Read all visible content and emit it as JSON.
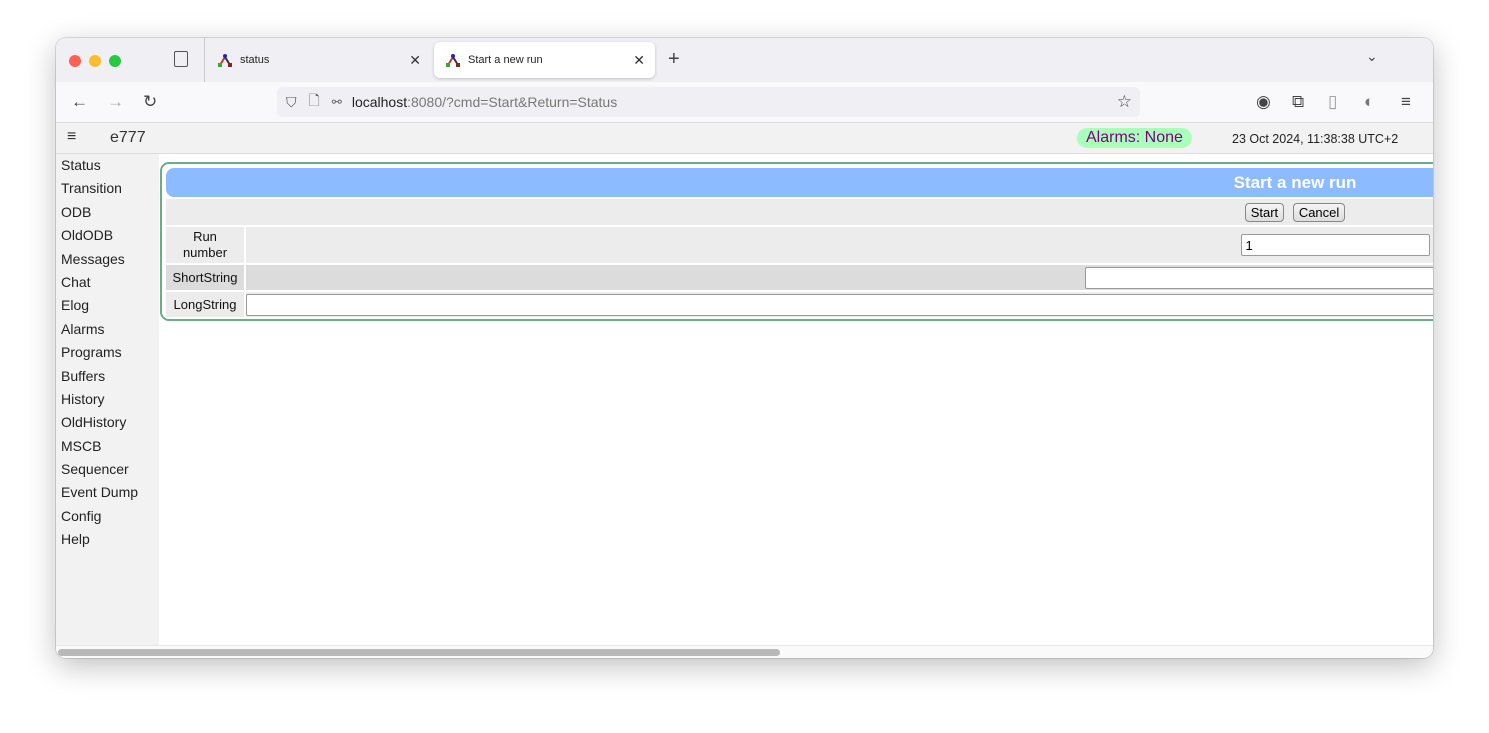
{
  "browser": {
    "tabs": [
      {
        "label": "status",
        "active": false
      },
      {
        "label": "Start a new run",
        "active": true
      }
    ],
    "url_host": "localhost",
    "url_rest": ":8080/?cmd=Start&Return=Status"
  },
  "header": {
    "experiment": "e777",
    "alarms": "Alarms: None",
    "datetime": "23 Oct 2024, 11:38:38 UTC+2"
  },
  "sidebar": {
    "items": [
      "Status",
      "Transition",
      "ODB",
      "OldODB",
      "Messages",
      "Chat",
      "Elog",
      "Alarms",
      "Programs",
      "Buffers",
      "History",
      "OldHistory",
      "MSCB",
      "Sequencer",
      "Event Dump",
      "Config",
      "Help"
    ]
  },
  "form": {
    "title": "Start a new run",
    "start_label": "Start",
    "cancel_label": "Cancel",
    "fields": [
      {
        "label": "Run number",
        "value": "1"
      },
      {
        "label": "ShortString",
        "value": ""
      },
      {
        "label": "LongString",
        "value": ""
      }
    ]
  },
  "colors": {
    "title_bar": "#8cbbff",
    "alarm_badge": "#aaffbb",
    "alarm_text": "#800080",
    "border": "#6cad84"
  }
}
